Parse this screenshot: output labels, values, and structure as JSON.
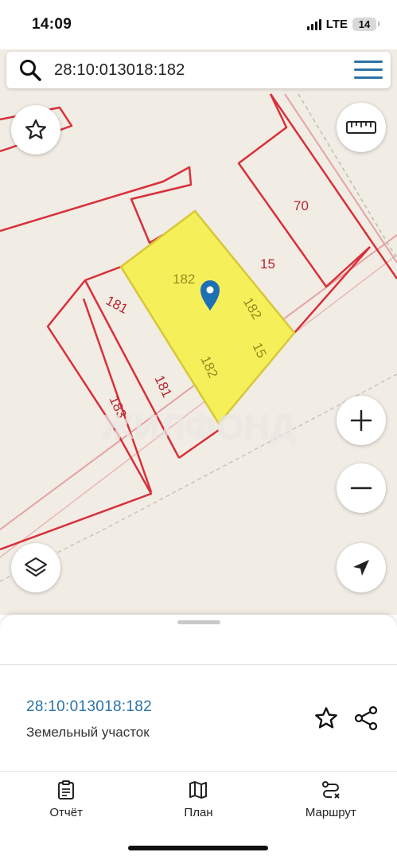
{
  "status_bar": {
    "time": "14:09",
    "network": "LTE",
    "battery": "14"
  },
  "search": {
    "query": "28:10:013018:182",
    "search_icon": "search-icon",
    "menu_icon": "hamburger-menu-icon"
  },
  "map": {
    "parcel_labels": [
      "182",
      "182",
      "182",
      "181",
      "181",
      "183",
      "15",
      "15",
      "70"
    ],
    "watermark": "ЖИЛФОНД",
    "highlight_color": "#f5f05a",
    "boundary_color": "#d8303a",
    "pin_color": "#1f6fb5",
    "controls": {
      "favorite_icon": "star-icon",
      "ruler_icon": "ruler-icon",
      "zoom_in_icon": "plus-icon",
      "zoom_out_icon": "minus-icon",
      "layers_icon": "layers-icon",
      "location_icon": "navigation-arrow-icon"
    }
  },
  "parcel": {
    "cadastral_number": "28:10:013018:182",
    "type": "Земельный участок",
    "favorite_icon": "star-outline-icon",
    "share_icon": "share-icon"
  },
  "tab_bar": {
    "items": [
      {
        "label": "Отчёт",
        "icon": "clipboard-icon"
      },
      {
        "label": "План",
        "icon": "map-icon"
      },
      {
        "label": "Маршрут",
        "icon": "route-icon"
      }
    ]
  }
}
